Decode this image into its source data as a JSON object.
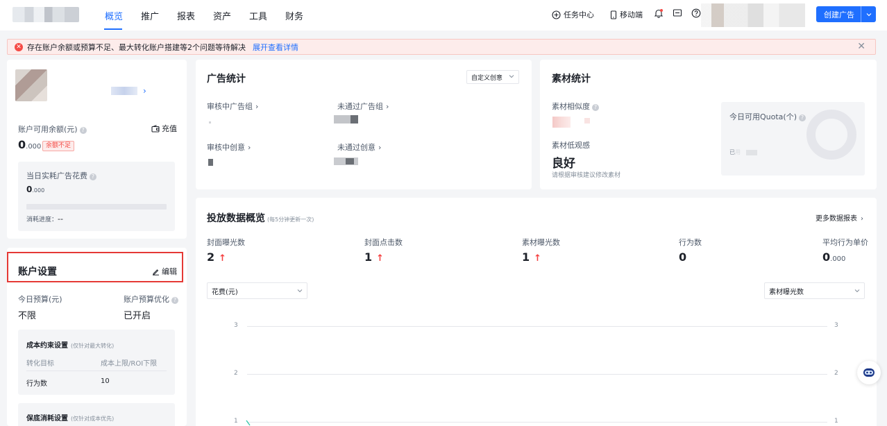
{
  "nav": {
    "tabs": [
      "概览",
      "推广",
      "报表",
      "资产",
      "工具",
      "财务"
    ],
    "active_tab": "概览",
    "task_center": "任务中心",
    "mobile": "移动端",
    "create_ad": "创建广告"
  },
  "alert": {
    "message": "存在账户余额或预算不足、最大转化账户搭建等2个问题等待解决",
    "link": "展开查看详情"
  },
  "account": {
    "balance_label": "账户可用余额(元)",
    "recharge": "充值",
    "balance_int": "0",
    "balance_dec": ".000",
    "insufficient_badge": "余额不足",
    "today_spend_label": "当日实耗广告花费",
    "today_spend_int": "0",
    "today_spend_dec": ".000",
    "progress_label": "消耗进度：",
    "progress_value": "--"
  },
  "settings": {
    "title": "账户设置",
    "edit": "编辑",
    "today_budget_label": "今日预算(元)",
    "today_budget_value": "不限",
    "budget_opt_label": "账户预算优化",
    "budget_opt_value": "已开启",
    "cost_constraint_title": "成本约束设置",
    "cost_constraint_note": "(仅针对最大转化)",
    "col_goal": "转化目标",
    "col_limit": "成本上限/ROI下限",
    "row_goal": "行为数",
    "row_limit": "10",
    "guarantee_title": "保底消耗设置",
    "guarantee_note": "(仅针对成本优先)"
  },
  "ad_stats": {
    "title": "广告统计",
    "dropdown": "自定义创意",
    "reviewing_group": "审核中广告组",
    "rejected_group": "未通过广告组",
    "reviewing_creative": "审核中创意",
    "rejected_creative": "未通过创意"
  },
  "material_stats": {
    "title": "素材统计",
    "similarity_label": "素材相似度",
    "low_quality_label": "素材低观感",
    "low_quality_value": "良好",
    "low_quality_hint": "请根据审核建议修改素材",
    "quota_label": "今日可用Quota(个)",
    "used_prefix": "已",
    "used_suffix_char": "用"
  },
  "overview": {
    "title": "投放数据概览",
    "note": "(每5分钟更新一次)",
    "more": "更多数据报表",
    "metrics": [
      {
        "label": "封面曝光数",
        "value": "2",
        "trend": "up"
      },
      {
        "label": "封面点击数",
        "value": "1",
        "trend": "up"
      },
      {
        "label": "素材曝光数",
        "value": "1",
        "trend": "up"
      },
      {
        "label": "行为数",
        "value": "0",
        "trend": ""
      },
      {
        "label": "平均行为单价",
        "value": "0",
        "dec": ".000",
        "trend": ""
      }
    ],
    "left_select": "花费(元)",
    "right_select": "素材曝光数"
  },
  "chart_data": {
    "type": "line",
    "title": "",
    "y_left_ticks": [
      "3",
      "2",
      "1"
    ],
    "y_right_ticks": [
      "3",
      "2",
      "1"
    ],
    "series": [
      {
        "name": "花费(元)",
        "color": "#2ec7a8"
      },
      {
        "name": "素材曝光数"
      }
    ]
  },
  "colors": {
    "primary": "#1f6fff",
    "danger": "#f54a45",
    "highlight_box": "#e53935"
  }
}
